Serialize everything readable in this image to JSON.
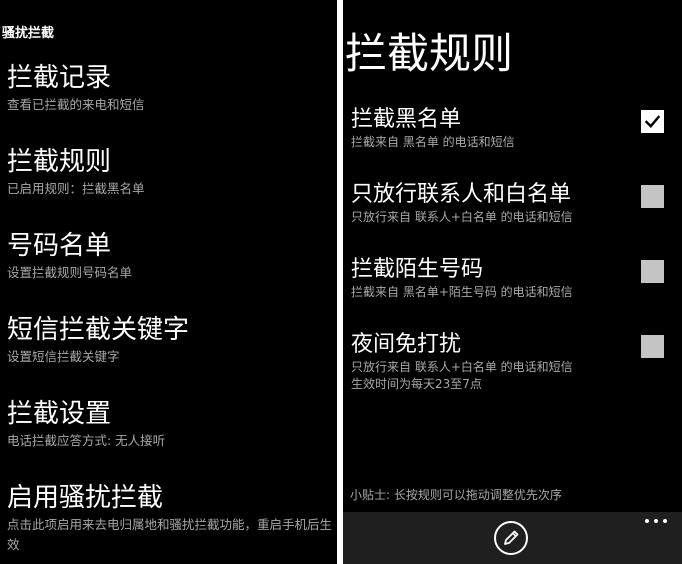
{
  "left": {
    "app_title": "骚扰拦截",
    "menu": [
      {
        "title": "拦截记录",
        "subtitle": "查看已拦截的来电和短信"
      },
      {
        "title": "拦截规则",
        "subtitle": "已启用规则：拦截黑名单"
      },
      {
        "title": "号码名单",
        "subtitle": "设置拦截规则号码名单"
      },
      {
        "title": "短信拦截关键字",
        "subtitle": "设置短信拦截关键字"
      },
      {
        "title": "拦截设置",
        "subtitle": "电话拦截应答方式: 无人接听"
      },
      {
        "title": "启用骚扰拦截",
        "subtitle": "点击此项启用来去电归属地和骚扰拦截功能，重启手机后生效"
      }
    ]
  },
  "right": {
    "page_title": "拦截规则",
    "rules": [
      {
        "title": "拦截黑名单",
        "subtitle": "拦截来自 黑名单 的电话和短信",
        "checked": true
      },
      {
        "title": "只放行联系人和白名单",
        "subtitle": "只放行来自 联系人+白名单 的电话和短信",
        "checked": false
      },
      {
        "title": "拦截陌生号码",
        "subtitle": "拦截来自 黑名单+陌生号码 的电话和短信",
        "checked": false
      },
      {
        "title": "夜间免打扰",
        "subtitle": "只放行来自 联系人+白名单 的电话和短信",
        "subtitle2": "生效时间为每天23至7点",
        "checked": false
      }
    ],
    "tip": "小贴士: 长按规则可以拖动调整优先次序",
    "app_bar": {
      "edit_icon": "pencil-icon",
      "more_icon": "ellipsis-icon"
    }
  },
  "colors": {
    "background": "#000000",
    "text_primary": "#ffffff",
    "text_secondary": "#a8a8a8",
    "checkbox_unchecked": "#c4c4c4",
    "app_bar": "#1f1f1f"
  }
}
